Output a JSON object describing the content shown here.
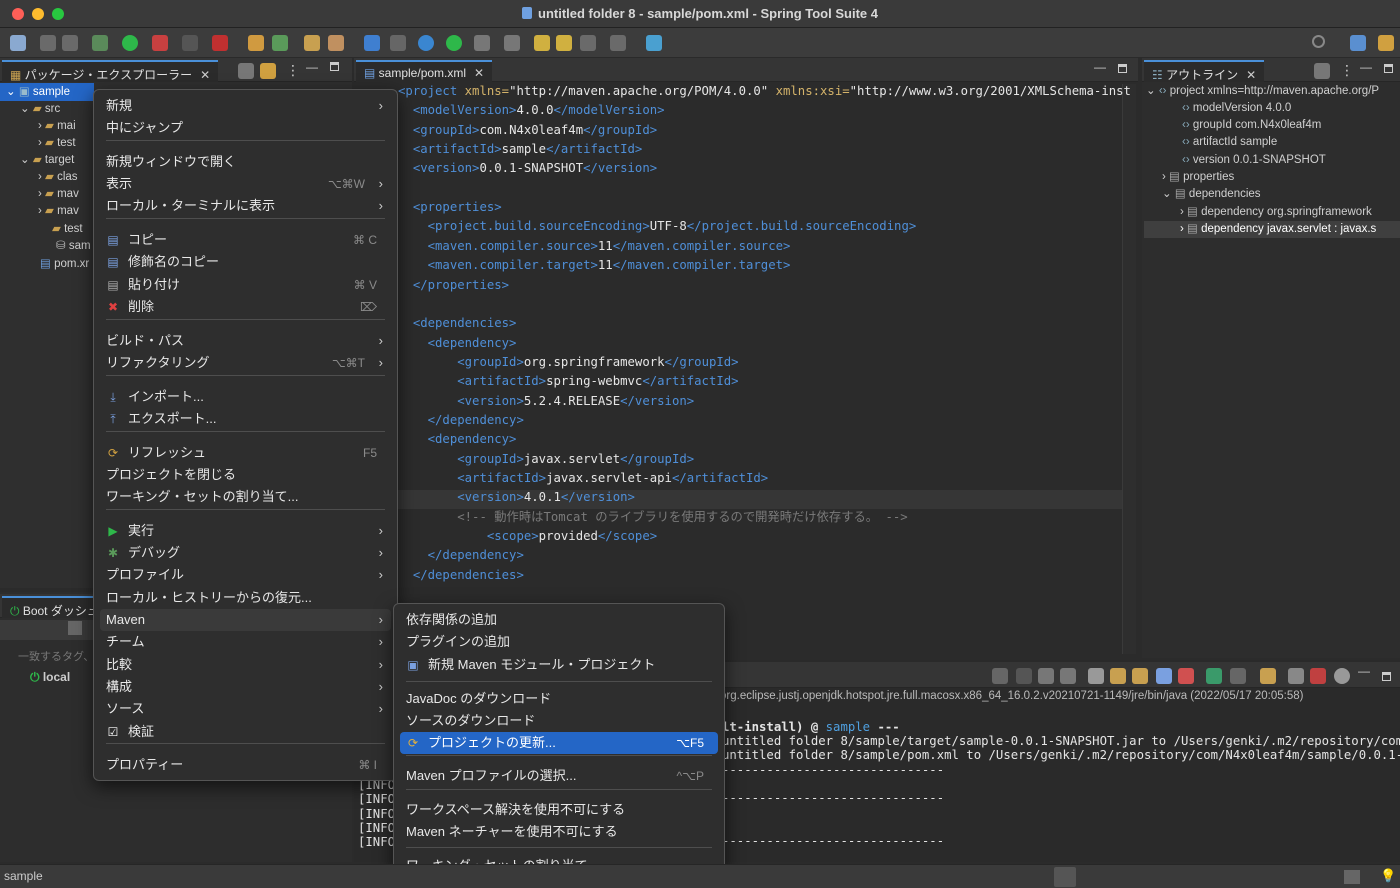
{
  "window": {
    "title": "untitled folder 8 - sample/pom.xml - Spring Tool Suite 4"
  },
  "package_explorer": {
    "tab_label": "パッケージ・エクスプローラー",
    "tree": [
      "sample",
      "src",
      "mai",
      "test",
      "target",
      "clas",
      "mav",
      "mav",
      "test",
      "sam",
      "pom.xr"
    ]
  },
  "boot_dashboard": {
    "tab_label": "Boot ダッシュ",
    "filter_placeholder": "一致するタグ、",
    "local": "local"
  },
  "editor": {
    "tab_label": "sample/pom.xml",
    "lines": [
      {
        "pre": "",
        "open": "<project",
        "rest": "",
        "attr": " xmlns=",
        "val": "\"http://maven.apache.org/POM/4.0.0\"",
        "attr2": " xmlns:xsi=",
        "val2": "\"http://www.w3.org/2001/XMLSchema-inst"
      },
      {
        "pre": "  ",
        "tag": "modelVersion",
        "text": "4.0.0"
      },
      {
        "pre": "  ",
        "tag": "groupId",
        "text": "com.N4x0leaf4m"
      },
      {
        "pre": "  ",
        "tag": "artifactId",
        "text": "sample"
      },
      {
        "pre": "  ",
        "tag": "version",
        "text": "0.0.1-SNAPSHOT"
      },
      {
        "pre": "",
        "blank": true
      },
      {
        "pre": "  ",
        "otag": "properties"
      },
      {
        "pre": "    ",
        "tag": "project.build.sourceEncoding",
        "text": "UTF-8"
      },
      {
        "pre": "    ",
        "tag": "maven.compiler.source",
        "text": "11"
      },
      {
        "pre": "    ",
        "tag": "maven.compiler.target",
        "text": "11"
      },
      {
        "pre": "  ",
        "ctag": "properties"
      },
      {
        "pre": "",
        "blank": true
      },
      {
        "pre": "  ",
        "otag": "dependencies"
      },
      {
        "pre": "    ",
        "otag": "dependency"
      },
      {
        "pre": "        ",
        "tag": "groupId",
        "text": "org.springframework"
      },
      {
        "pre": "        ",
        "tag": "artifactId",
        "text": "spring-webmvc"
      },
      {
        "pre": "        ",
        "tag": "version",
        "text": "5.2.4.RELEASE"
      },
      {
        "pre": "    ",
        "ctag": "dependency"
      },
      {
        "pre": "    ",
        "otag": "dependency"
      },
      {
        "pre": "        ",
        "tag": "groupId",
        "text": "javax.servlet"
      },
      {
        "pre": "        ",
        "tag": "artifactId",
        "text": "javax.servlet-api"
      },
      {
        "pre": "        ",
        "tag": "version",
        "text": "4.0.1"
      },
      {
        "pre": "        ",
        "comment": "<!-- 動作時はTomcat のライブラリを使用するので開発時だけ依存する。 -->"
      },
      {
        "pre": "            ",
        "tag": "scope",
        "text": "provided"
      },
      {
        "pre": "    ",
        "ctag": "dependency"
      },
      {
        "pre": "  ",
        "ctag": "dependencies"
      }
    ]
  },
  "outline": {
    "tab_label": "アウトライン",
    "items": [
      "project xmlns=http://maven.apache.org/P",
      "modelVersion  4.0.0",
      "groupId  com.N4x0leaf4m",
      "artifactId  sample",
      "version  0.0.1-SNAPSHOT",
      "properties",
      "dependencies",
      "dependency  org.springframework",
      "dependency  javax.servlet : javax.s"
    ]
  },
  "console": {
    "header": "org.eclipse.justj.openjdk.hotspot.jre.full.macosx.x86_64_16.0.2.v20210721-1149/jre/bin/java (2022/05/17 20:05:58)",
    "lines": [
      "lt-install) @ sample ---",
      "untitled folder 8/sample/target/sample-0.0.1-SNAPSHOT.jar to /Users/genki/.m2/repository/com",
      "untitled folder 8/sample/pom.xml to /Users/genki/.m2/repository/com/N4x0leaf4m/sample/0.0.1-",
      "------------------------------",
      "",
      "------------------------------",
      "",
      "",
      "------------------------------"
    ],
    "info_lines": [
      "[INFO",
      "[INFO",
      "[INFO",
      "[INFO",
      "[INFO"
    ],
    "sample_link": "sample"
  },
  "context_menu": {
    "items": [
      {
        "label": "新規",
        "sub": true
      },
      {
        "label": "中にジャンプ"
      },
      {
        "label": "新規ウィンドウで開く"
      },
      {
        "label": "表示",
        "shortcut": "⌥⌘W",
        "sub": true
      },
      {
        "label": "ローカル・ターミナルに表示",
        "sub": true
      },
      {
        "label": "コピー",
        "shortcut": "⌘ C",
        "icon": true
      },
      {
        "label": "修飾名のコピー",
        "icon": true
      },
      {
        "label": "貼り付け",
        "shortcut": "⌘ V",
        "icon": true
      },
      {
        "label": "削除",
        "shortcut": "⌦",
        "icon": true
      },
      {
        "label": "ビルド・パス",
        "sub": true
      },
      {
        "label": "リファクタリング",
        "shortcut": "⌥⌘T",
        "sub": true
      },
      {
        "label": "インポート...",
        "icon": true
      },
      {
        "label": "エクスポート...",
        "icon": true
      },
      {
        "label": "リフレッシュ",
        "shortcut": "F5",
        "icon": true
      },
      {
        "label": "プロジェクトを閉じる"
      },
      {
        "label": "ワーキング・セットの割り当て..."
      },
      {
        "label": "実行",
        "sub": true,
        "icon": true
      },
      {
        "label": "デバッグ",
        "sub": true,
        "icon": true
      },
      {
        "label": "プロファイル",
        "sub": true
      },
      {
        "label": "ローカル・ヒストリーからの復元..."
      },
      {
        "label": "Maven",
        "sub": true
      },
      {
        "label": "チーム",
        "sub": true
      },
      {
        "label": "比較",
        "sub": true
      },
      {
        "label": "構成",
        "sub": true
      },
      {
        "label": "ソース",
        "sub": true
      },
      {
        "label": "検証",
        "icon": true
      },
      {
        "label": "プロパティー",
        "shortcut": "⌘ I"
      }
    ]
  },
  "maven_submenu": {
    "items": [
      {
        "label": "依存関係の追加"
      },
      {
        "label": "プラグインの追加"
      },
      {
        "label": "新規 Maven モジュール・プロジェクト"
      },
      {
        "label": "JavaDoc のダウンロード"
      },
      {
        "label": "ソースのダウンロード"
      },
      {
        "label": "プロジェクトの更新...",
        "shortcut": "⌥F5"
      },
      {
        "label": "Maven プロファイルの選択...",
        "shortcut": "^⌥P"
      },
      {
        "label": "ワークスペース解決を使用不可にする"
      },
      {
        "label": "Maven ネーチャーを使用不可にする"
      },
      {
        "label": "ワーキング・セットの割り当て..."
      }
    ]
  },
  "status": {
    "left": "sample"
  }
}
